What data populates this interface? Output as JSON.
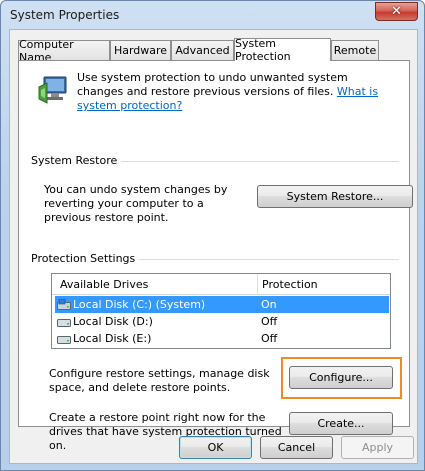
{
  "window": {
    "title": "System Properties",
    "close_symbol": "✕"
  },
  "tabs": [
    {
      "label": "Computer Name",
      "active": false
    },
    {
      "label": "Hardware",
      "active": false
    },
    {
      "label": "Advanced",
      "active": false
    },
    {
      "label": "System Protection",
      "active": true
    },
    {
      "label": "Remote",
      "active": false
    }
  ],
  "intro": {
    "icon": "system-protection-icon",
    "text": "Use system protection to undo unwanted system changes and restore previous versions of files.",
    "link": "What is system protection?"
  },
  "system_restore": {
    "heading": "System Restore",
    "text": "You can undo system changes by reverting your computer to a previous restore point.",
    "button": "System Restore..."
  },
  "protection_settings": {
    "heading": "Protection Settings",
    "columns": [
      "Available Drives",
      "Protection"
    ],
    "drives": [
      {
        "name": "Local Disk (C:) (System)",
        "protection": "On",
        "selected": true,
        "icon": "system-drive-icon"
      },
      {
        "name": "Local Disk (D:)",
        "protection": "Off",
        "selected": false,
        "icon": "drive-icon"
      },
      {
        "name": "Local Disk (E:)",
        "protection": "Off",
        "selected": false,
        "icon": "drive-icon"
      }
    ],
    "configure_text": "Configure restore settings, manage disk space, and delete restore points.",
    "configure_button": "Configure...",
    "create_text": "Create a restore point right now for the drives that have system protection turned on.",
    "create_button": "Create..."
  },
  "footer": {
    "ok": "OK",
    "cancel": "Cancel",
    "apply": "Apply"
  },
  "colors": {
    "selection": "#3399ff",
    "link": "#0066cc",
    "highlight_box": "#ee8b29"
  }
}
